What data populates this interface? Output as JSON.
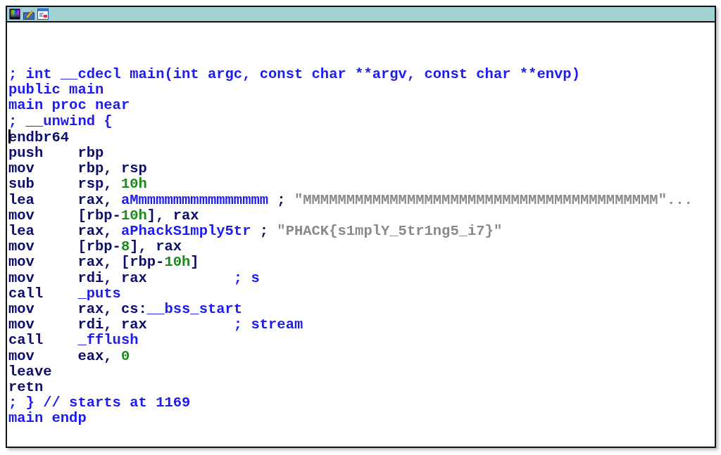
{
  "toolbar": {
    "icons": [
      {
        "kind": "palette"
      },
      {
        "kind": "pencil"
      },
      {
        "kind": "window"
      }
    ]
  },
  "lines": [
    {
      "kind": "directive",
      "cursor": false,
      "tokens": [
        {
          "kind": "comment",
          "text": "; int __cdecl main(int argc, const char **argv, const char **envp)"
        }
      ]
    },
    {
      "kind": "directive",
      "cursor": false,
      "tokens": [
        {
          "kind": "comment",
          "text": "public main"
        }
      ]
    },
    {
      "kind": "directive",
      "cursor": false,
      "tokens": [
        {
          "kind": "comment",
          "text": "main proc near"
        }
      ]
    },
    {
      "kind": "directive",
      "cursor": false,
      "tokens": [
        {
          "kind": "comment",
          "text": "; __unwind {"
        }
      ]
    },
    {
      "kind": "instruction",
      "cursor": true,
      "mnemonic": "endbr64"
    },
    {
      "kind": "instruction",
      "cursor": false,
      "mnemonic": "push",
      "operands": [
        {
          "kind": "reg",
          "text": "rbp"
        }
      ]
    },
    {
      "kind": "instruction",
      "cursor": false,
      "mnemonic": "mov",
      "operands": [
        {
          "kind": "reg",
          "text": "rbp, rsp"
        }
      ]
    },
    {
      "kind": "instruction",
      "cursor": false,
      "mnemonic": "sub",
      "operands": [
        {
          "kind": "reg",
          "text": "rsp, "
        },
        {
          "kind": "number",
          "text": "10h"
        }
      ]
    },
    {
      "kind": "instruction",
      "cursor": false,
      "mnemonic": "lea",
      "operands": [
        {
          "kind": "reg",
          "text": "rax, "
        },
        {
          "kind": "name",
          "text": "aMmmmmmmmmmmmmmmm"
        }
      ],
      "comment": [
        {
          "kind": "punct",
          "text": "; "
        },
        {
          "kind": "string",
          "text": "\"MMMMMMMMMMMMMMMMMMMMMMMMMMMMMMMMMMMMMMMMM\"..."
        }
      ]
    },
    {
      "kind": "instruction",
      "cursor": false,
      "mnemonic": "mov",
      "operands": [
        {
          "kind": "reg",
          "text": "[rbp-"
        },
        {
          "kind": "number",
          "text": "10h"
        },
        {
          "kind": "reg",
          "text": "], rax"
        }
      ]
    },
    {
      "kind": "instruction",
      "cursor": false,
      "mnemonic": "lea",
      "operands": [
        {
          "kind": "reg",
          "text": "rax, "
        },
        {
          "kind": "name",
          "text": "aPhackS1mply5tr"
        }
      ],
      "comment": [
        {
          "kind": "punct",
          "text": "; "
        },
        {
          "kind": "string",
          "text": "\"PHACK{s1mplY_5tr1ng5_i7}\""
        }
      ]
    },
    {
      "kind": "instruction",
      "cursor": false,
      "mnemonic": "mov",
      "operands": [
        {
          "kind": "reg",
          "text": "[rbp-"
        },
        {
          "kind": "number",
          "text": "8"
        },
        {
          "kind": "reg",
          "text": "], rax"
        }
      ]
    },
    {
      "kind": "instruction",
      "cursor": false,
      "mnemonic": "mov",
      "operands": [
        {
          "kind": "reg",
          "text": "rax, [rbp-"
        },
        {
          "kind": "number",
          "text": "10h"
        },
        {
          "kind": "reg",
          "text": "]"
        }
      ]
    },
    {
      "kind": "instruction",
      "cursor": false,
      "mnemonic": "mov",
      "operands": [
        {
          "kind": "reg",
          "text": "rdi, rax"
        }
      ],
      "comment": [
        {
          "kind": "comment",
          "text": "; s"
        }
      ]
    },
    {
      "kind": "instruction",
      "cursor": false,
      "mnemonic": "call",
      "operands": [
        {
          "kind": "name",
          "text": "_puts"
        }
      ]
    },
    {
      "kind": "instruction",
      "cursor": false,
      "mnemonic": "mov",
      "operands": [
        {
          "kind": "reg",
          "text": "rax, cs:"
        },
        {
          "kind": "name",
          "text": "__bss_start"
        }
      ]
    },
    {
      "kind": "instruction",
      "cursor": false,
      "mnemonic": "mov",
      "operands": [
        {
          "kind": "reg",
          "text": "rdi, rax"
        }
      ],
      "comment": [
        {
          "kind": "comment",
          "text": "; stream"
        }
      ]
    },
    {
      "kind": "instruction",
      "cursor": false,
      "mnemonic": "call",
      "operands": [
        {
          "kind": "name",
          "text": "_fflush"
        }
      ]
    },
    {
      "kind": "instruction",
      "cursor": false,
      "mnemonic": "mov",
      "operands": [
        {
          "kind": "reg",
          "text": "eax, "
        },
        {
          "kind": "number",
          "text": "0"
        }
      ]
    },
    {
      "kind": "instruction",
      "cursor": false,
      "mnemonic": "leave"
    },
    {
      "kind": "instruction",
      "cursor": false,
      "mnemonic": "retn"
    },
    {
      "kind": "directive",
      "cursor": false,
      "tokens": [
        {
          "kind": "comment",
          "text": "; } // starts at 1169"
        }
      ]
    },
    {
      "kind": "directive",
      "cursor": false,
      "tokens": [
        {
          "kind": "comment",
          "text": "main endp"
        }
      ]
    }
  ]
}
